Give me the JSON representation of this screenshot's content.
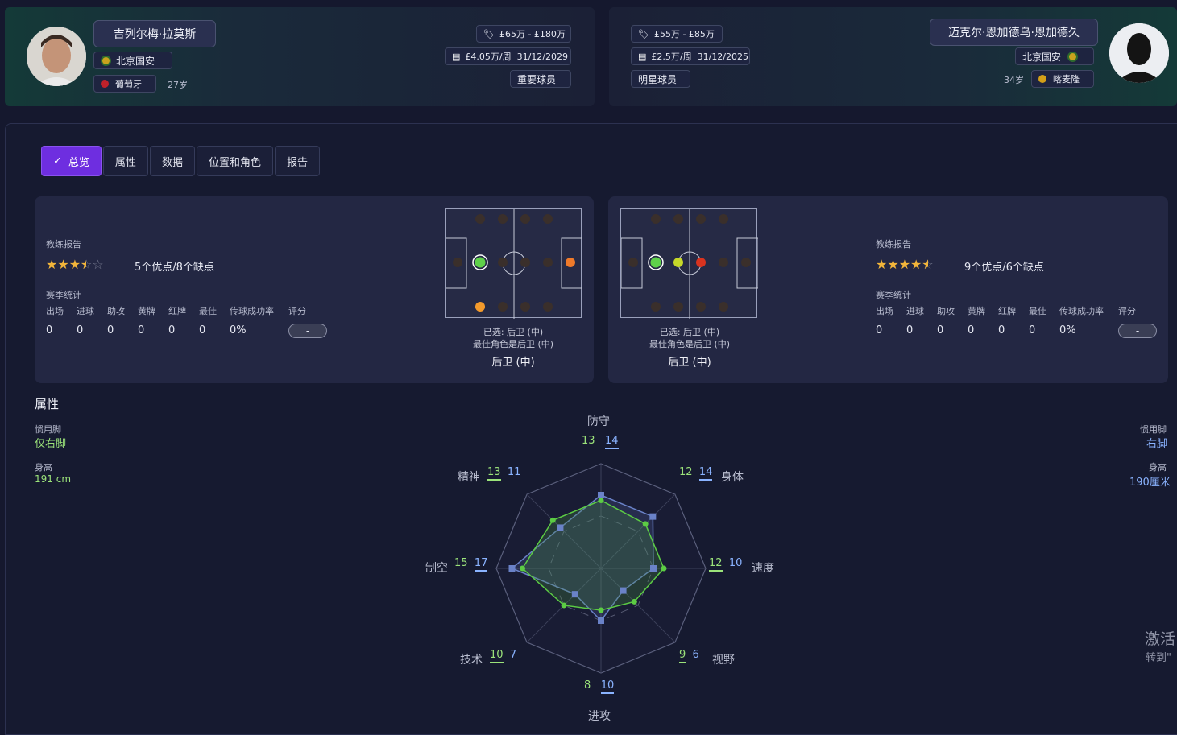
{
  "player_left": {
    "name": "吉列尔梅·拉莫斯",
    "club": "北京国安",
    "nation": "葡萄牙",
    "age": "27岁",
    "value_range": "£65万 - £180万",
    "wage": "£4.05万/周",
    "contract_end": "31/12/2029",
    "status": "重要球员"
  },
  "player_right": {
    "name": "迈克尔·恩加德乌·恩加德久",
    "club": "北京国安",
    "nation": "喀麦隆",
    "age": "34岁",
    "value_range": "£55万 - £85万",
    "wage": "£2.5万/周",
    "contract_end": "31/12/2025",
    "status": "明星球员"
  },
  "tabs": [
    "总览",
    "属性",
    "数据",
    "位置和角色",
    "报告"
  ],
  "coach_report_label": "教练报告",
  "season_stats_label": "赛季统计",
  "stat_headers": [
    "出场",
    "进球",
    "助攻",
    "黄牌",
    "红牌",
    "最佳",
    "传球成功率",
    "评分"
  ],
  "left_card": {
    "stars": 3.5,
    "summary": "5个优点/8个缺点",
    "stats": [
      "0",
      "0",
      "0",
      "0",
      "0",
      "0",
      "0%"
    ],
    "rating": "-",
    "selected": "已选: 后卫 (中)",
    "best_role": "最佳角色是后卫 (中)",
    "position": "后卫 (中)"
  },
  "right_card": {
    "stars": 4.5,
    "summary": "9个优点/6个缺点",
    "stats": [
      "0",
      "0",
      "0",
      "0",
      "0",
      "0",
      "0%"
    ],
    "rating": "-",
    "selected": "已选: 后卫 (中)",
    "best_role": "最佳角色是后卫 (中)",
    "position": "后卫 (中)"
  },
  "attributes_title": "属性",
  "left_attr": {
    "foot_label": "惯用脚",
    "foot": "仅右脚",
    "height_label": "身高",
    "height": "191 cm"
  },
  "right_attr": {
    "foot_label": "惯用脚",
    "foot": "右脚",
    "height_label": "身高",
    "height": "190厘米"
  },
  "radar": {
    "axes": [
      "防守",
      "身体",
      "速度",
      "视野",
      "进攻",
      "技术",
      "制空",
      "精神"
    ],
    "left_values": [
      13,
      12,
      12,
      9,
      8,
      10,
      15,
      13
    ],
    "right_values": [
      14,
      14,
      10,
      6,
      10,
      7,
      17,
      11
    ],
    "max": 20,
    "left_color": "#5ccc44",
    "right_color": "#6a82c8"
  },
  "watermark": {
    "line1": "激活",
    "line2": "转到\""
  }
}
